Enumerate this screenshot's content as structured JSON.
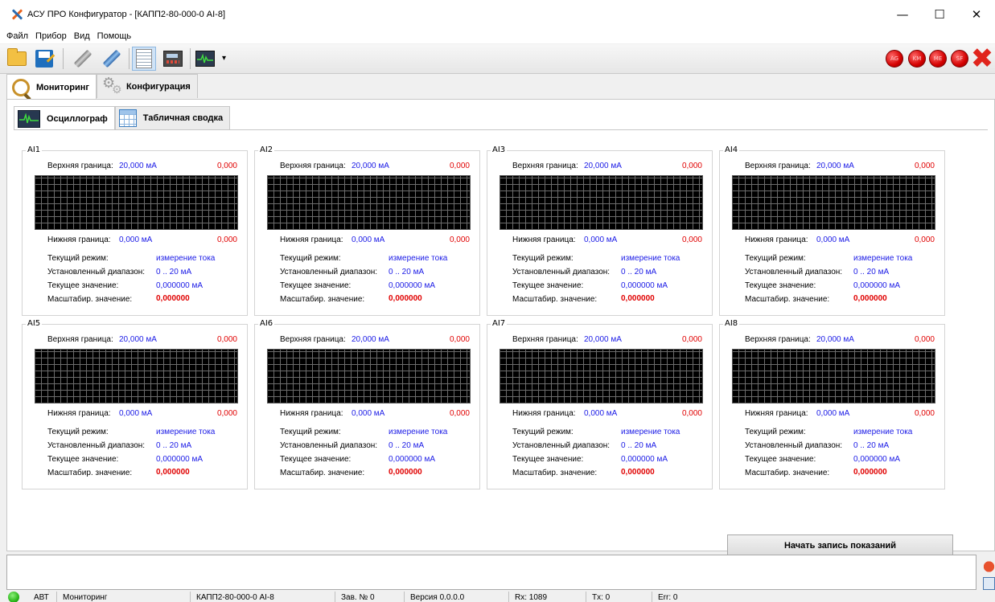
{
  "window": {
    "title": "АСУ ПРО Конфигуратор - [КАПП2-80-000-0 AI-8]",
    "minimize": "—",
    "maximize": "☐",
    "close": "✕"
  },
  "menu": [
    "Файл",
    "Прибор",
    "Вид",
    "Помощь"
  ],
  "toolbar": {
    "buttons": [
      "open-icon",
      "save-icon",
      "disconnect-icon",
      "connect-icon",
      "list-view-icon",
      "panel-view-icon",
      "oscilloscope-icon"
    ],
    "dropdown_arrow": "▾",
    "indicators": [
      "AG",
      "KM",
      "ME",
      "SF"
    ],
    "indicator_color": "#d40000",
    "stop_icon": "✖"
  },
  "tabs_main": [
    {
      "label": "Мониторинг",
      "active": true
    },
    {
      "label": "Конфигурация",
      "active": false
    }
  ],
  "tabs_sub": [
    {
      "label": "Осциллограф",
      "active": true
    },
    {
      "label": "Табличная сводка",
      "active": false
    }
  ],
  "channels": [
    {
      "name": "AI1",
      "upper_label": "Верхняя граница:",
      "upper_value": "20,000 мА",
      "upper_scaled": "0,000",
      "lower_label": "Нижняя граница:",
      "lower_value": "0,000 мА",
      "lower_scaled": "0,000",
      "mode_label": "Текущий режим:",
      "mode_value": "измерение тока",
      "range_label": "Установленный диапазон:",
      "range_value": "0 .. 20 мА",
      "current_label": "Текущее значение:",
      "current_value": "0,000000 мА",
      "scaled_label": "Масштабир. значение:",
      "scaled_value": "0,000000"
    },
    {
      "name": "AI2",
      "upper_label": "Верхняя граница:",
      "upper_value": "20,000 мА",
      "upper_scaled": "0,000",
      "lower_label": "Нижняя граница:",
      "lower_value": "0,000 мА",
      "lower_scaled": "0,000",
      "mode_label": "Текущий режим:",
      "mode_value": "измерение тока",
      "range_label": "Установленный диапазон:",
      "range_value": "0 .. 20 мА",
      "current_label": "Текущее значение:",
      "current_value": "0,000000 мА",
      "scaled_label": "Масштабир. значение:",
      "scaled_value": "0,000000"
    },
    {
      "name": "AI3",
      "upper_label": "Верхняя граница:",
      "upper_value": "20,000 мА",
      "upper_scaled": "0,000",
      "lower_label": "Нижняя граница:",
      "lower_value": "0,000 мА",
      "lower_scaled": "0,000",
      "mode_label": "Текущий режим:",
      "mode_value": "измерение тока",
      "range_label": "Установленный диапазон:",
      "range_value": "0 .. 20 мА",
      "current_label": "Текущее значение:",
      "current_value": "0,000000 мА",
      "scaled_label": "Масштабир. значение:",
      "scaled_value": "0,000000"
    },
    {
      "name": "AI4",
      "upper_label": "Верхняя граница:",
      "upper_value": "20,000 мА",
      "upper_scaled": "0,000",
      "lower_label": "Нижняя граница:",
      "lower_value": "0,000 мА",
      "lower_scaled": "0,000",
      "mode_label": "Текущий режим:",
      "mode_value": "измерение тока",
      "range_label": "Установленный диапазон:",
      "range_value": "0 .. 20 мА",
      "current_label": "Текущее значение:",
      "current_value": "0,000000 мА",
      "scaled_label": "Масштабир. значение:",
      "scaled_value": "0,000000"
    },
    {
      "name": "AI5",
      "upper_label": "Верхняя граница:",
      "upper_value": "20,000 мА",
      "upper_scaled": "0,000",
      "lower_label": "Нижняя граница:",
      "lower_value": "0,000 мА",
      "lower_scaled": "0,000",
      "mode_label": "Текущий режим:",
      "mode_value": "измерение тока",
      "range_label": "Установленный диапазон:",
      "range_value": "0 .. 20 мА",
      "current_label": "Текущее значение:",
      "current_value": "0,000000 мА",
      "scaled_label": "Масштабир. значение:",
      "scaled_value": "0,000000"
    },
    {
      "name": "AI6",
      "upper_label": "Верхняя граница:",
      "upper_value": "20,000 мА",
      "upper_scaled": "0,000",
      "lower_label": "Нижняя граница:",
      "lower_value": "0,000 мА",
      "lower_scaled": "0,000",
      "mode_label": "Текущий режим:",
      "mode_value": "измерение тока",
      "range_label": "Установленный диапазон:",
      "range_value": "0 .. 20 мА",
      "current_label": "Текущее значение:",
      "current_value": "0,000000 мА",
      "scaled_label": "Масштабир. значение:",
      "scaled_value": "0,000000"
    },
    {
      "name": "AI7",
      "upper_label": "Верхняя граница:",
      "upper_value": "20,000 мА",
      "upper_scaled": "0,000",
      "lower_label": "Нижняя граница:",
      "lower_value": "0,000 мА",
      "lower_scaled": "0,000",
      "mode_label": "Текущий режим:",
      "mode_value": "измерение тока",
      "range_label": "Установленный диапазон:",
      "range_value": "0 .. 20 мА",
      "current_label": "Текущее значение:",
      "current_value": "0,000000 мА",
      "scaled_label": "Масштабир. значение:",
      "scaled_value": "0,000000"
    },
    {
      "name": "AI8",
      "upper_label": "Верхняя граница:",
      "upper_value": "20,000 мА",
      "upper_scaled": "0,000",
      "lower_label": "Нижняя граница:",
      "lower_value": "0,000 мА",
      "lower_scaled": "0,000",
      "mode_label": "Текущий режим:",
      "mode_value": "измерение тока",
      "range_label": "Установленный диапазон:",
      "range_value": "0 .. 20 мА",
      "current_label": "Текущее значение:",
      "current_value": "0,000000 мА",
      "scaled_label": "Масштабир. значение:",
      "scaled_value": "0,000000"
    }
  ],
  "record_button": "Начать запись показаний",
  "statusbar": {
    "connection_led_color": "#2bb61a",
    "mode_short": "АВТ",
    "mode": "Мониторинг",
    "device": "КАПП2-80-000-0 AI-8",
    "serial": "Зав. № 0",
    "version": "Версия 0.0.0.0",
    "rx": "Rx: 1089",
    "tx": "Tx: 0",
    "err": "Err: 0"
  },
  "colors": {
    "value_blue": "#1a1ae6",
    "value_red": "#e00000",
    "scope_bg": "#000000",
    "scope_grid": "#6c6c6c"
  }
}
